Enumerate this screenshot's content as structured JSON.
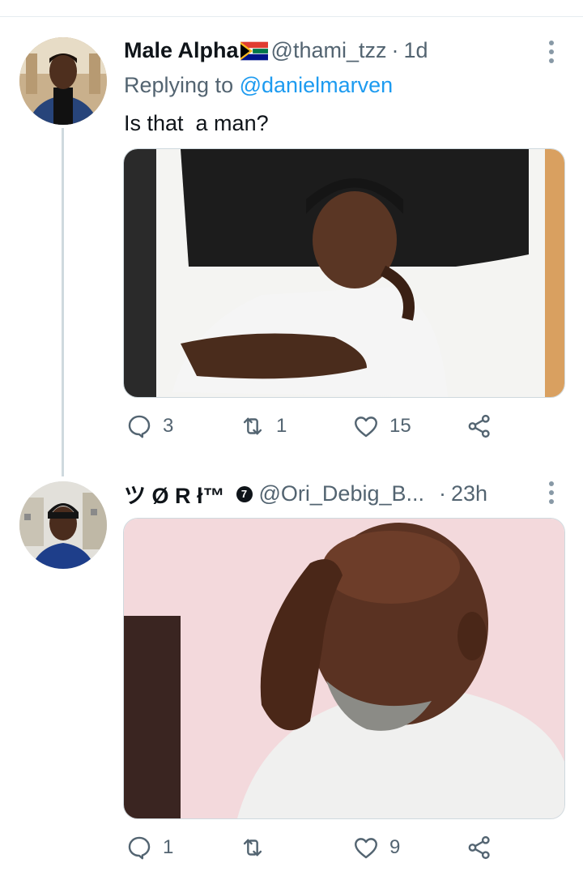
{
  "thread": [
    {
      "author_name": "Male Alpha",
      "handle": "@thami_tzz",
      "time": "1d",
      "reply_prefix": "Replying to",
      "reply_to": "@danielmarven",
      "text": "Is that  a man?",
      "stats": {
        "replies": "3",
        "retweets": "1",
        "likes": "15"
      }
    },
    {
      "author_name": "ツ Ø R ł™",
      "badge": "7",
      "handle": "@Ori_Debig_B...",
      "time": "23h",
      "stats": {
        "replies": "1",
        "retweets": "",
        "likes": "9"
      }
    }
  ],
  "separator": "·",
  "colors": {
    "accent": "#1d9bf0",
    "secondary_text": "#536471",
    "thread_line": "#cfd9de"
  }
}
